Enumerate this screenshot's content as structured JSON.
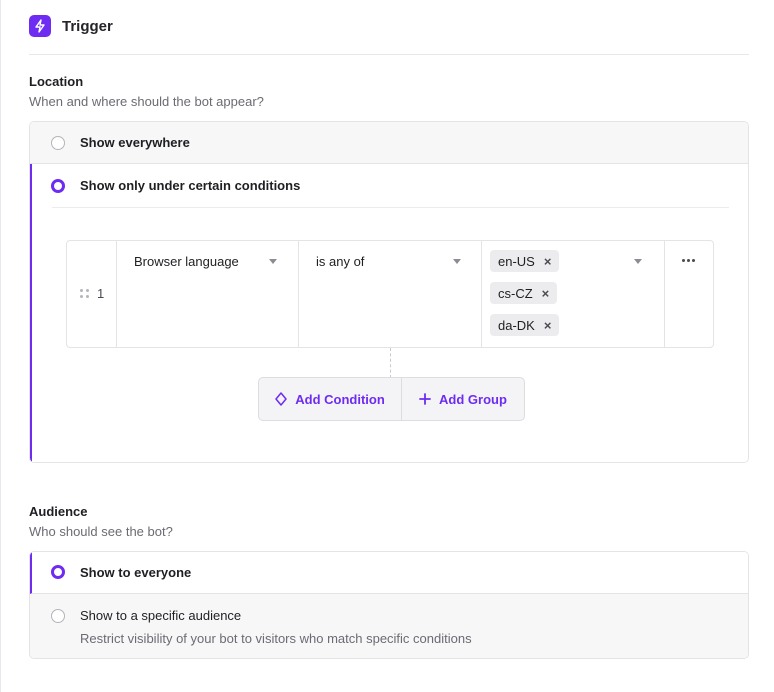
{
  "header": {
    "title": "Trigger",
    "icon": "lightning-icon"
  },
  "location": {
    "title": "Location",
    "subtitle": "When and where should the bot appear?",
    "options": [
      {
        "label": "Show everywhere",
        "selected": false
      },
      {
        "label": "Show only under certain conditions",
        "selected": true
      }
    ],
    "condition": {
      "index": "1",
      "field": "Browser language",
      "operator": "is any of",
      "values": [
        "en-US",
        "cs-CZ",
        "da-DK"
      ]
    },
    "actions": {
      "add_condition": "Add Condition",
      "add_group": "Add Group"
    }
  },
  "audience": {
    "title": "Audience",
    "subtitle": "Who should see the bot?",
    "options": [
      {
        "label": "Show to everyone",
        "selected": true
      },
      {
        "label": "Show to a specific audience",
        "description": "Restrict visibility of your bot to visitors who match specific conditions",
        "selected": false
      }
    ]
  },
  "colors": {
    "accent": "#6e2cf2",
    "border": "#e4e4e8",
    "muted_text": "#6b6b73"
  }
}
